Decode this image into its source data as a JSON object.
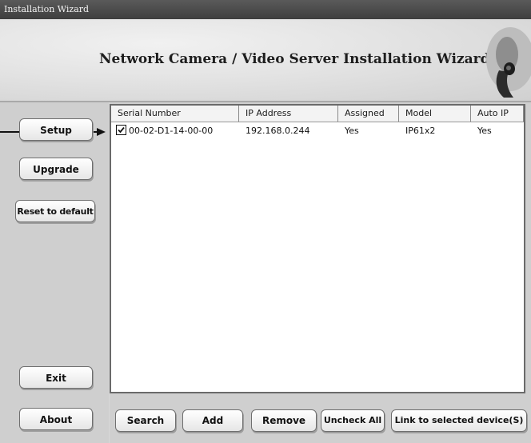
{
  "window": {
    "title": "Installation Wizard"
  },
  "banner": {
    "title": "Network Camera / Video Server Installation Wizard",
    "logo_icon": "camera-icon"
  },
  "sidebar": {
    "buttons": [
      {
        "label": "Setup"
      },
      {
        "label": "Upgrade"
      },
      {
        "label": "Reset to default"
      },
      {
        "label": "Exit"
      },
      {
        "label": "About"
      }
    ],
    "pointer_icon": "arrow-right-icon"
  },
  "device_list": {
    "columns": [
      "Serial Number",
      "IP Address",
      "Assigned",
      "Model",
      "Auto IP"
    ],
    "rows": [
      {
        "checked": true,
        "serial": "00-02-D1-14-00-00",
        "ip": "192.168.0.244",
        "assigned": "Yes",
        "model": "IP61x2",
        "auto_ip": "Yes"
      }
    ]
  },
  "actions": {
    "search": "Search",
    "add": "Add",
    "remove": "Remove",
    "uncheck_all": "Uncheck All",
    "link": "Link to selected device(S)"
  },
  "colors": {
    "titlebar": "#4a4a4a",
    "panel": "#cfcfcf",
    "list_bg": "#ffffff"
  }
}
